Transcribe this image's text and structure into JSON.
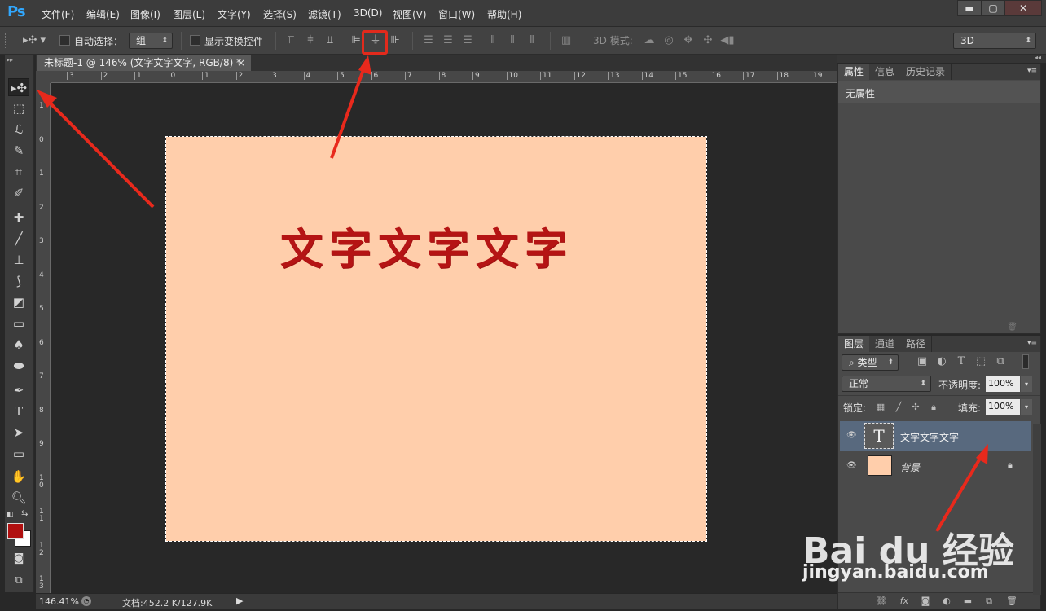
{
  "app": {
    "logo": "Ps"
  },
  "menu": [
    "文件(F)",
    "编辑(E)",
    "图像(I)",
    "图层(L)",
    "文字(Y)",
    "选择(S)",
    "滤镜(T)",
    "3D(D)",
    "视图(V)",
    "窗口(W)",
    "帮助(H)"
  ],
  "window_controls": {
    "minimize": "▬",
    "maximize": "▢",
    "close": "✕"
  },
  "options_bar": {
    "auto_select_label": "自动选择：",
    "auto_select_value": "组",
    "show_transform_label": "显示变换控件",
    "mode_3d_label": "3D 模式:",
    "workspace_value": "3D"
  },
  "document_tab": {
    "title": "未标题-1 @ 146% (文字文字文字, RGB/8) *",
    "close": "×"
  },
  "ruler_top_labels": [
    "3",
    "2",
    "1",
    "0",
    "1",
    "2",
    "3",
    "4",
    "5",
    "6",
    "7",
    "8",
    "9",
    "10",
    "11",
    "12",
    "13",
    "14",
    "15",
    "16",
    "17",
    "18",
    "19"
  ],
  "ruler_left_labels": [
    "1",
    "0",
    "1",
    "2",
    "3",
    "4",
    "5",
    "6",
    "7",
    "8",
    "9",
    "1\n0",
    "1\n1",
    "1\n2",
    "1\n3"
  ],
  "canvas": {
    "text_layer_content": "文字文字文字",
    "background_color": "#ffceab",
    "text_color": "#b51414"
  },
  "status": {
    "zoom": "146.41%",
    "doc_info": "文档:452.2 K/127.9K"
  },
  "properties_panel": {
    "tabs": [
      "属性",
      "信息",
      "历史记录"
    ],
    "content": "无属性"
  },
  "layers_panel": {
    "tabs": [
      "图层",
      "通道",
      "路径"
    ],
    "filter_kind": "类型",
    "blend_mode": "正常",
    "opacity_label": "不透明度:",
    "opacity_value": "100%",
    "lock_label": "锁定:",
    "fill_label": "填充:",
    "fill_value": "100%",
    "layers": [
      {
        "name": "文字文字文字",
        "type": "text",
        "selected": true
      },
      {
        "name": "背景",
        "type": "background",
        "locked": true
      }
    ]
  },
  "watermark": {
    "brand": "Bai du 经验",
    "url": "jingyan.baidu.com"
  },
  "colors": {
    "foreground": "#b01010",
    "background": "#ffffff",
    "annotation_red": "#e8291c"
  }
}
